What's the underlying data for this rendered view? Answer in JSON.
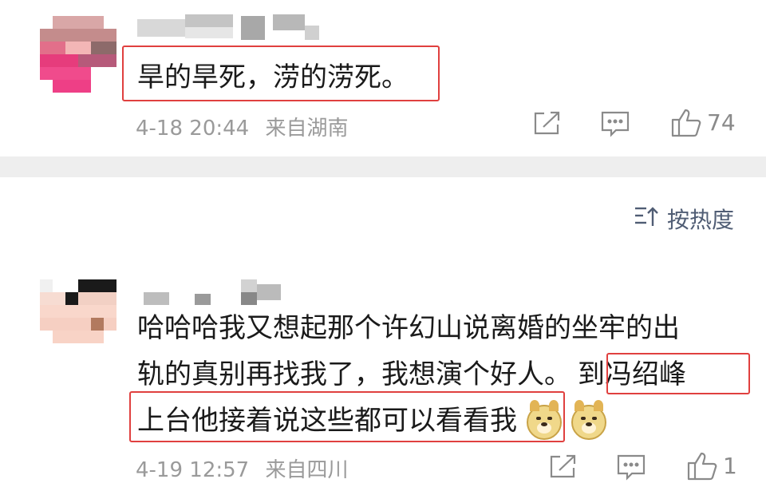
{
  "comments": [
    {
      "text_lines": [
        "旱的旱死，涝的涝死。"
      ],
      "time": "4-18 20:44",
      "location": "来自湖南",
      "likes": "74"
    },
    {
      "text_lines": [
        "哈哈哈我又想起那个许幻山说离婚的坐牢的出",
        "轨的真别再找我了，我想演个好人。",
        "到冯绍峰",
        "上台他接着说这些都可以看看我"
      ],
      "emojis": [
        "doge-emoji",
        "doge-emoji"
      ],
      "time": "4-19 12:57",
      "location": "来自四川",
      "likes": "1"
    }
  ],
  "sort": {
    "label": "按热度",
    "icon": "sort-icon"
  },
  "icons": {
    "share": "share-icon",
    "reply": "comment-icon",
    "like": "thumbs-up-icon"
  },
  "colors": {
    "highlight": "#e0403f",
    "meta": "#9a9a9a",
    "sort": "#505d74",
    "divider": "#eeeeee"
  }
}
